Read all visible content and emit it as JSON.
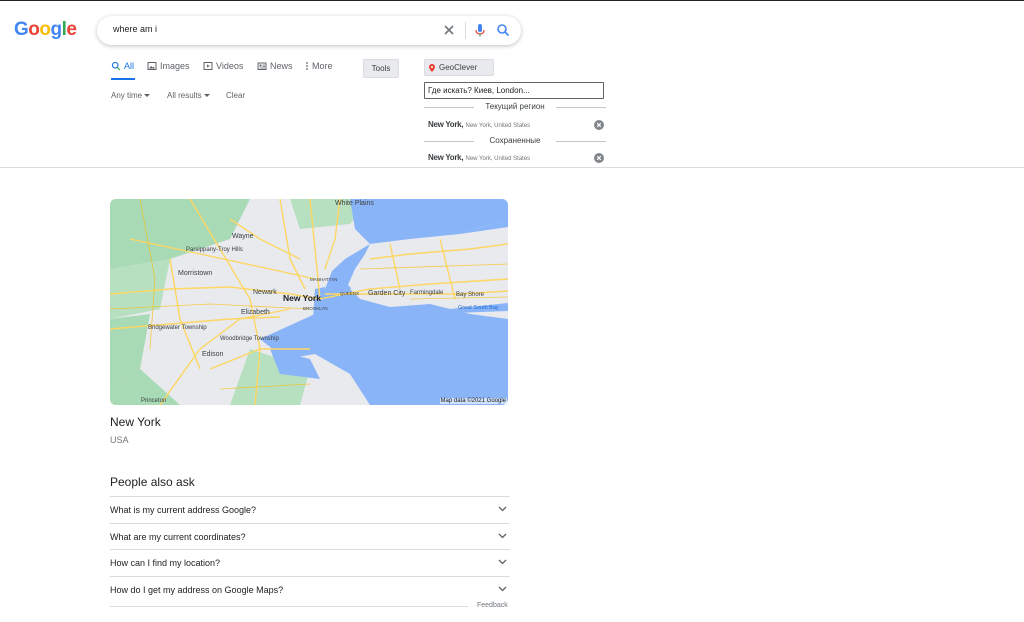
{
  "logo": {
    "letters": [
      "G",
      "o",
      "o",
      "g",
      "l",
      "e"
    ]
  },
  "search": {
    "query": "where am i"
  },
  "tabs": [
    {
      "label": "All",
      "icon": "search-icon"
    },
    {
      "label": "Images",
      "icon": "image-icon"
    },
    {
      "label": "Videos",
      "icon": "play-icon"
    },
    {
      "label": "News",
      "icon": "news-icon"
    },
    {
      "label": "More",
      "icon": "more-vert-icon"
    }
  ],
  "tools_label": "Tools",
  "filters": {
    "time": "Any time",
    "results": "All results",
    "clear": "Clear"
  },
  "geoclever": {
    "button_label": "GeoClever",
    "input_placeholder": "Где искать? Киев, London...",
    "current_region_label": "Текущий регион",
    "saved_label": "Сохраненные",
    "current": {
      "city": "New York,",
      "region": "New York, United States"
    },
    "saved": {
      "city": "New York,",
      "region": "New York, United States"
    }
  },
  "map": {
    "attribution": "Map data ©2021 Google",
    "labels": {
      "new_york": "New York",
      "newark": "Newark",
      "elizabeth": "Elizabeth",
      "morristown": "Morristown",
      "parsippany": "Parsippany-Troy Hills",
      "wayne": "Wayne",
      "white_plains": "White Plains",
      "garden_city": "Garden City",
      "farmingdale": "Farmingdale",
      "bay_shore": "Bay Shore",
      "great_south_bay": "Great South Bay",
      "bridgewater": "Bridgewater Township",
      "woodbridge": "Woodbridge Township",
      "edison": "Edison",
      "princeton": "Princeton",
      "manhattan": "MANHATTAN",
      "queens": "QUEENS",
      "brooklyn": "BROOKLYN"
    }
  },
  "place": {
    "title": "New York",
    "subtitle": "USA"
  },
  "people_also_ask": {
    "title": "People also ask",
    "questions": [
      "What is my current address Google?",
      "What are my current coordinates?",
      "How can I find my location?",
      "How do I get my address on Google Maps?"
    ]
  },
  "feedback_label": "Feedback",
  "colors": {
    "accent": "#1a73e8",
    "map_water": "#8ab4f8",
    "map_land": "#e8eaed",
    "map_park": "#a8dab5",
    "map_road": "#fdd663"
  }
}
